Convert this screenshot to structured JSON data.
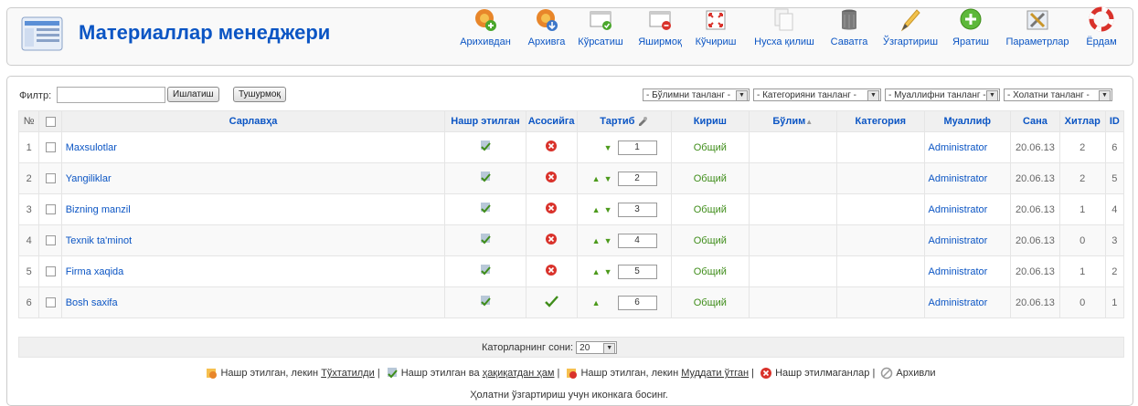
{
  "header": {
    "title": "Материаллар менеджери",
    "toolbar": [
      {
        "id": "unarchive",
        "label": "Арихивдан",
        "icon": "unarchive-icon"
      },
      {
        "id": "archive",
        "label": "Архивга",
        "icon": "archive-icon"
      },
      {
        "id": "publish",
        "label": "Кўрсатиш",
        "icon": "publish-icon"
      },
      {
        "id": "unpublish",
        "label": "Яширмоқ",
        "icon": "unpublish-icon"
      },
      {
        "id": "move",
        "label": "Кўчириш",
        "icon": "move-icon"
      },
      {
        "id": "copy",
        "label": "Нусха қилиш",
        "icon": "copy-icon"
      },
      {
        "id": "trash",
        "label": "Саватга",
        "icon": "trash-icon"
      },
      {
        "id": "edit",
        "label": "Ўзгартириш",
        "icon": "edit-icon"
      },
      {
        "id": "new",
        "label": "Яратиш",
        "icon": "new-icon"
      },
      {
        "id": "params",
        "label": "Параметрлар",
        "icon": "params-icon"
      },
      {
        "id": "help",
        "label": "Ёрдам",
        "icon": "help-icon"
      }
    ]
  },
  "filter": {
    "label": "Филтр:",
    "value": "",
    "go_label": "Ишлатиш",
    "reset_label": "Тушурмоқ",
    "selects": [
      "- Бўлимни танланг -",
      "- Категорияни танланг -",
      "- Муаллифни танланг -",
      "- Холатни танланг -"
    ]
  },
  "table": {
    "columns": {
      "num": "№",
      "title": "Сарлавҳа",
      "published": "Нашр этилган",
      "frontpage": "Асосийга",
      "order": "Тартиб",
      "access": "Кириш",
      "section": "Бўлим",
      "category": "Категория",
      "author": "Муаллиф",
      "date": "Сана",
      "hits": "Хитлар",
      "id": "ID"
    },
    "rows": [
      {
        "num": "1",
        "title": "Maxsulotlar",
        "frontpage": "no",
        "order": "1",
        "access": "Общий",
        "author": "Administrator",
        "date": "20.06.13",
        "hits": "2",
        "id": "6",
        "up": false,
        "down": true
      },
      {
        "num": "2",
        "title": "Yangiliklar",
        "frontpage": "no",
        "order": "2",
        "access": "Общий",
        "author": "Administrator",
        "date": "20.06.13",
        "hits": "2",
        "id": "5",
        "up": true,
        "down": true
      },
      {
        "num": "3",
        "title": "Bizning manzil",
        "frontpage": "no",
        "order": "3",
        "access": "Общий",
        "author": "Administrator",
        "date": "20.06.13",
        "hits": "1",
        "id": "4",
        "up": true,
        "down": true
      },
      {
        "num": "4",
        "title": "Texnik ta'minot",
        "frontpage": "no",
        "order": "4",
        "access": "Общий",
        "author": "Administrator",
        "date": "20.06.13",
        "hits": "0",
        "id": "3",
        "up": true,
        "down": true
      },
      {
        "num": "5",
        "title": "Firma xaqida",
        "frontpage": "no",
        "order": "5",
        "access": "Общий",
        "author": "Administrator",
        "date": "20.06.13",
        "hits": "1",
        "id": "2",
        "up": true,
        "down": true
      },
      {
        "num": "6",
        "title": "Bosh saxifa",
        "frontpage": "yes",
        "order": "6",
        "access": "Общий",
        "author": "Administrator",
        "date": "20.06.13",
        "hits": "0",
        "id": "1",
        "up": true,
        "down": false
      }
    ]
  },
  "footer": {
    "rows_label": "Каторларнинг сони:",
    "rows_value": "20"
  },
  "legend": {
    "item1_prefix": "Нашр этилган, лекин",
    "item1_link": "Тўхтатилди",
    "item2_prefix": "Нашр этилган ва",
    "item2_link": "ҳақиқатдан ҳам",
    "item3_prefix": "Нашр этилган, лекин",
    "item3_link": "Муддати ўтган",
    "item4": "Нашр этилмаганлар",
    "item5": "Архивли",
    "sep": "|",
    "hint": "Ҳолатни ўзгартириш учун иконкага босинг."
  },
  "colors": {
    "accent": "#0b55c4",
    "green": "#3f8d1a",
    "red": "#d9322b"
  }
}
